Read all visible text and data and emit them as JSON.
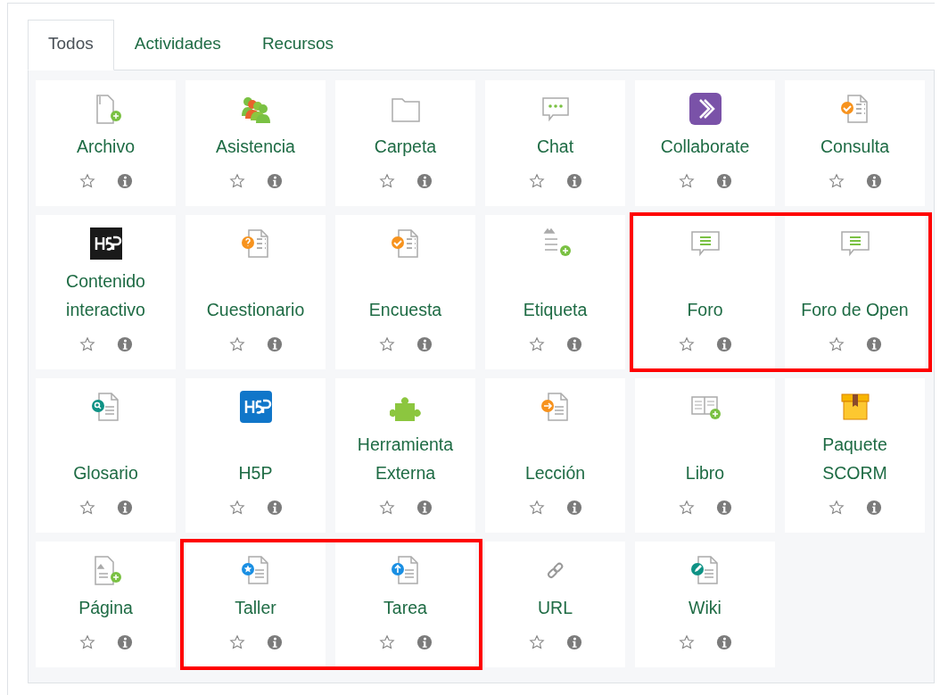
{
  "tabs": [
    {
      "label": "Todos",
      "selected": true
    },
    {
      "label": "Actividades",
      "selected": false
    },
    {
      "label": "Recursos",
      "selected": false
    }
  ],
  "modules": [
    {
      "name": "Archivo",
      "kind": "file",
      "highlighted": false
    },
    {
      "name": "Asistencia",
      "kind": "attendance",
      "highlighted": false
    },
    {
      "name": "Carpeta",
      "kind": "folder",
      "highlighted": false
    },
    {
      "name": "Chat",
      "kind": "chat",
      "highlighted": false
    },
    {
      "name": "Collaborate",
      "kind": "collaborate",
      "highlighted": false
    },
    {
      "name": "Consulta",
      "kind": "choice",
      "highlighted": false
    },
    {
      "name": "Contenido interactivo",
      "kind": "h5pdark",
      "highlighted": false
    },
    {
      "name": "Cuestionario",
      "kind": "quiz",
      "highlighted": false
    },
    {
      "name": "Encuesta",
      "kind": "survey",
      "highlighted": false
    },
    {
      "name": "Etiqueta",
      "kind": "label",
      "highlighted": false
    },
    {
      "name": "Foro",
      "kind": "forum",
      "highlighted": true
    },
    {
      "name": "Foro de Open",
      "kind": "forum",
      "highlighted": true
    },
    {
      "name": "Glosario",
      "kind": "glossary",
      "highlighted": false
    },
    {
      "name": "H5P",
      "kind": "h5p",
      "highlighted": false
    },
    {
      "name": "Herramienta Externa",
      "kind": "lti",
      "highlighted": false
    },
    {
      "name": "Lección",
      "kind": "lesson",
      "highlighted": false
    },
    {
      "name": "Libro",
      "kind": "book",
      "highlighted": false
    },
    {
      "name": "Paquete SCORM",
      "kind": "scorm",
      "highlighted": false
    },
    {
      "name": "Página",
      "kind": "page",
      "highlighted": false
    },
    {
      "name": "Taller",
      "kind": "workshop",
      "highlighted": true
    },
    {
      "name": "Tarea",
      "kind": "assign",
      "highlighted": true
    },
    {
      "name": "URL",
      "kind": "url",
      "highlighted": false
    },
    {
      "name": "Wiki",
      "kind": "wiki",
      "highlighted": false
    }
  ]
}
